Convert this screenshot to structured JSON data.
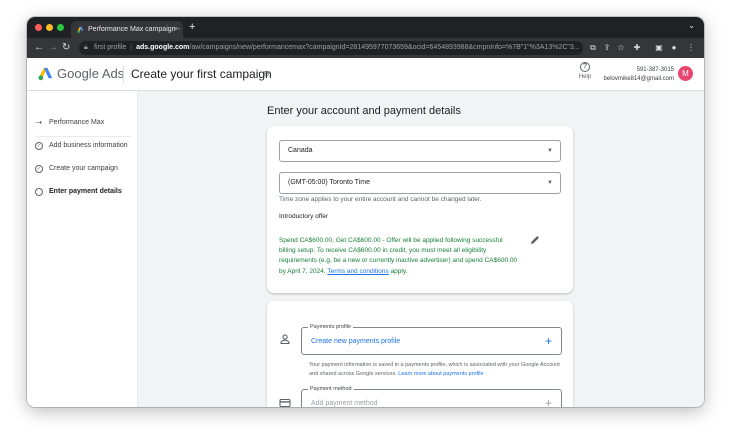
{
  "browser": {
    "tab_title": "Performance Max campaign -",
    "tab_close": "×",
    "new_tab": "+",
    "tab_menu": "⌄",
    "url_prefix": "first profile",
    "url_host": "ads.google.com",
    "url_path": "/aw/campaigns/new/performancemax?campaignId=281495977073659&ocid=6454893988&cmpnInfo=%7B\"1\"%3A13%2C\"3...",
    "colors": {
      "tabstrip": "#202124",
      "toolbar": "#35363a",
      "close": "#ff5f57",
      "minimize": "#febc2e",
      "zoom": "#28c840"
    }
  },
  "header": {
    "product": "Google Ads",
    "title": "Create your first campaign",
    "help_label": "Help",
    "account_id": "591-387-3015",
    "account_email": "belovmike814@gmail.com",
    "avatar_letter": "M",
    "avatar_color": "#e8456f"
  },
  "sidebar": {
    "items": [
      {
        "label": "Performance Max",
        "icon": "arrow-icon",
        "state": "done"
      },
      {
        "label": "Add business information",
        "icon": "check-circle-icon",
        "state": "done"
      },
      {
        "label": "Create your campaign",
        "icon": "check-circle-icon",
        "state": "done"
      },
      {
        "label": "Enter payment details",
        "icon": "circle-icon",
        "state": "current"
      }
    ]
  },
  "main": {
    "section_title": "Enter your account and payment details",
    "country": "Canada",
    "timezone": "(GMT-05:00) Toronto Time",
    "timezone_note": "Time zone applies to your entire account and cannot be changed later.",
    "intro_label": "Introductory offer",
    "offer_text": "Spend CA$600.00, Get CA$600.00 - Offer will be applied following successful billing setup. To receive CA$600.00 in credit, you must meet all eligibility requirements (e.g. be a new or currently inactive advertiser) and spend CA$600.00 by April 7, 2024.",
    "offer_link": "Terms and conditions",
    "offer_tail": "apply.",
    "payments_profile_legend": "Payments profile",
    "payments_profile_value": "Create new payments profile",
    "payments_note": "Your payment information is saved in a payments profile, which is associated with your Google Account and shared across Google services.",
    "payments_note_link": "Learn more about payments profile",
    "payment_method_legend": "Payment method",
    "payment_method_placeholder": "Add payment method"
  }
}
